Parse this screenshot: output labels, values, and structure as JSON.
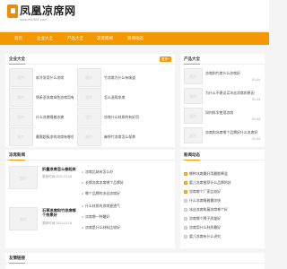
{
  "site": {
    "name": "凤凰凉席网",
    "url": "www.fh1981.com"
  },
  "nav": [
    "首页",
    "企业大全",
    "产品大全",
    "凉席新闻",
    "新闻动态"
  ],
  "more_label": "更多+",
  "thumb_label": "图片",
  "enterprises": {
    "title": "企业大全",
    "items": [
      [
        "软冷发用什么凉席",
        "竹凉席为什么有味道"
      ],
      [
        "锦禾圣凉席绿色凉席用有",
        "怎么选购凉席"
      ],
      [
        "什么凉席睡着凉爽",
        "凉席什么材质的有好用"
      ],
      [
        "最需超级凉的凉席有哪些",
        "麻将竹凉席怎么保养"
      ]
    ]
  },
  "products": {
    "title": "产品大全",
    "items": [
      {
        "text": "凉席和竹席什么凉席好",
        "date": "01-04"
      },
      {
        "text": "为什么不建议买冰丝凉席的原因",
        "date": "01-04"
      },
      {
        "text": "如何科学使用凉席",
        "date": "01-04"
      },
      {
        "text": "凉席和冰席哪个品牌好什么凉席好",
        "date": "01-04"
      }
    ]
  },
  "news": {
    "title": "凉席新闻",
    "date_prefix": "更新时间",
    "feature1": {
      "title": "折叠凉席怎么卷起来",
      "date": "2021-01-04"
    },
    "feature2": {
      "title": "石草凉席和竹凉席哪个效果好",
      "date": "2021-01-04"
    },
    "list": [
      "凉席比纳米怎么办",
      "长期凉席凉席哪个品牌好",
      "哪个品牌的冰丝凉席好",
      "什么材质的凉席更透气",
      "凉席哪一种最好",
      "凉席是什么材料比较好"
    ]
  },
  "dynamics": {
    "title": "新闻动态",
    "items": [
      "哪种冰席最好用最能降温",
      "婴儿凉席推荐什么品牌的好",
      "凉席哪个厂家比较好",
      "什么凉席睡着最凉快",
      "冰丝凉席和藤凉席哪个好",
      "凉席哪个牌子质量好",
      "凉席用什么材质最好",
      "婴儿凉席有什么讲究",
      "竹凉席和藤凉席区别"
    ]
  },
  "links": {
    "title": "友情链接"
  }
}
